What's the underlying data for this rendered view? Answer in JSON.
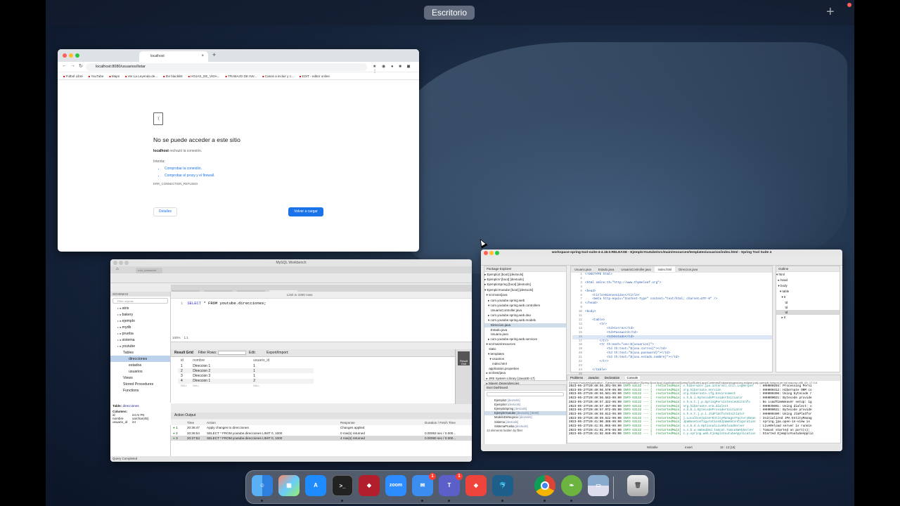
{
  "desktop": {
    "space_label": "Escritorio",
    "add_label": "+"
  },
  "chrome": {
    "tab_title": "localhost",
    "tab_close": "×",
    "new_tab": "+",
    "url": "localhost:8080/usuarios/listar",
    "bookmarks": [
      "Fútbol Libre",
      "YouTube",
      "Maps",
      "Ver La Leyenda de...",
      "the blacklist",
      "HOJAS_DE_VIDA...",
      "TRABAJO DE INV...",
      "Casos a incluir y c...",
      "EDIT - editor online"
    ],
    "heading": "No se puede acceder a este sitio",
    "host": "localhost",
    "message": "rechazó la conexión.",
    "try_label": "Intenta:",
    "suggestions": [
      "Comprobar la conexión.",
      "Comprobar el proxy y el firewall."
    ],
    "error_code": "ERR_CONNECTION_REFUSED",
    "details_button": "Detalles",
    "reload_button": "Volver a cargar"
  },
  "workbench": {
    "title": "MySQL Workbench",
    "connection_tab": "root_password",
    "query_tabs": [
      "Administration",
      "Schemas",
      "Query 1",
      "usuarios",
      "estados",
      "direcciones"
    ],
    "schemas_header": "SCHEMAS",
    "filter_placeholder": "Filter objects",
    "schemas": [
      "atrix",
      "bakery",
      "ejemplo",
      "mydb",
      "prueba",
      "sistema",
      "youtube"
    ],
    "tables_label": "Tables",
    "tables": [
      "direcciones",
      "estados",
      "usuarios"
    ],
    "views_label": "Views",
    "procedures_label": "Stored Procedures",
    "functions_label": "Functions",
    "limit_label": "Limit to 1000 rows",
    "query_line": "1",
    "query_kw1": "SELECT",
    "query_rest": "* FROM youtube.direcciones;",
    "zoom": "100%",
    "cursor_pos": "1:1",
    "result_grid_label": "Result Grid",
    "filter_rows_label": "Filter Rows:",
    "edit_label": "Edit:",
    "export_label": "Export/Import:",
    "result_grid_side": "Result Grid",
    "grid_headers": [
      "id",
      "nombre",
      "usuario_id"
    ],
    "grid_rows": [
      [
        "1",
        "Direccion 1",
        "1"
      ],
      [
        "2",
        "Direccion 2",
        "1"
      ],
      [
        "3",
        "Direccion 3",
        "1"
      ],
      [
        "4",
        "Direccion 1",
        "2"
      ],
      [
        "NULL",
        "NULL",
        "NULL"
      ]
    ],
    "info_table_prefix": "Table:",
    "info_table": "direcciones",
    "info_columns_label": "Columns:",
    "info_columns": [
      [
        "id",
        "int AI PK"
      ],
      [
        "nombre",
        "varchar(45)"
      ],
      [
        "usuario_id",
        "int"
      ]
    ],
    "output_label": "Action Output",
    "output_headers": [
      "",
      "Time",
      "Action",
      "Response",
      "Duration / Fetch Time"
    ],
    "output_rows": [
      [
        "1",
        "20:36:47",
        "Apply changes to direcciones",
        "Changes applied",
        ""
      ],
      [
        "2",
        "20:36:54",
        "SELECT * FROM youtube.direcciones LIMIT 0, 1000",
        "0 row(s) returned",
        "0.00063 sec / 0.000..."
      ],
      [
        "3",
        "20:37:53",
        "SELECT * FROM youtube.direcciones LIMIT 0, 1000",
        "4 row(s) returned",
        "0.00060 sec / 0.000..."
      ]
    ],
    "status": "Query Completed"
  },
  "sts": {
    "title": "workspace-spring-tool-suite-4-4.18.0.RELEASE - EjemploYoutube/src/main/resources/templates/usuarios/index.html - Spring Tool Suite 4",
    "explorer_label": "Package Explorer",
    "explorer_items": [
      "▸ Ejemplo2 [boot] [devtools]",
      "▸ EjemploV [boot] [devtools]",
      "▸ EjemploSpring [boot] [devtools]",
      "▾ EjemploYoutube [boot] [devtools]",
      "  ▾ src/main/java",
      "    ▸ com.youtube.spring.web",
      "    ▾ com.youtube.spring.web.controllers",
      "       UsuarioController.java",
      "    ▸ com.youtube.spring.web.dao",
      "    ▾ com.youtube.spring.web.models",
      "       Direccion.java",
      "       Estado.java",
      "       Usuario.java",
      "    ▸ com.youtube.spring.web.services",
      "  ▾ src/main/resources",
      "     static",
      "    ▾ templates",
      "      ▾ usuarios",
      "         index.html",
      "     application.properties",
      "  ▸ src/test/java",
      "  ▸ JRE System Library [JavaSE-17]",
      "  ▸ Maven Dependencies"
    ],
    "explorer_selected": 10,
    "editor_tabs": [
      "Usuario.java",
      "Estado.java",
      "UsuarioController.java",
      "index.html",
      "Direccion.java"
    ],
    "editor_active_tab": 3,
    "code": [
      [
        "1",
        "<!DOCTYPE html>"
      ],
      [
        "2",
        ""
      ],
      [
        "3",
        "<html xmlns:th=\"http://www.thymeleaf.org\">"
      ],
      [
        "4",
        ""
      ],
      [
        "5",
        "<head>"
      ],
      [
        "6",
        "    <title>Bienvenidos</title>"
      ],
      [
        "7",
        "    <meta http-equiv=\"Content-Type\" content=\"text/html; charset=UTF-8\" />"
      ],
      [
        "8",
        "</head>"
      ],
      [
        "9",
        ""
      ],
      [
        "10",
        "<body>"
      ],
      [
        "11",
        ""
      ],
      [
        "12",
        "    <table>"
      ],
      [
        "13",
        "        <tr>"
      ],
      [
        "14",
        "            <td>Correo</td>"
      ],
      [
        "15",
        "            <td>Password</td>"
      ],
      [
        "16",
        "            <td>Estado</td>"
      ],
      [
        "17",
        "        </tr>"
      ],
      [
        "18",
        "        <tr th:each=\"usu:${usuarios}\">"
      ],
      [
        "19",
        "            <td th:text=\"${usu.correo}\"></td>"
      ],
      [
        "20",
        "            <td th:text=\"${usu.password}\"></td>"
      ],
      [
        "21",
        "            <td th:text=\"${usu.estado.nombre}\"></td>"
      ],
      [
        "22",
        "        </tr>"
      ],
      [
        "23",
        ""
      ],
      [
        "24",
        "    </table>"
      ],
      [
        "25",
        ""
      ]
    ],
    "outline_label": "Outline",
    "outline_items": [
      "▾ html",
      "  ▸ head",
      "  ▾ body",
      "    ▾ table",
      "      ▾ tr",
      "          td",
      "          td",
      "          td",
      "      ▸ tr"
    ],
    "outline_selected": 7,
    "boot_label": "Boot Dashboard",
    "boot_items": [
      [
        "Ejemplo2",
        "[devtools]"
      ],
      [
        "EjemploV",
        "[devtools]"
      ],
      [
        "EjemploSpring",
        "[devtools]"
      ],
      [
        "EjemploYoutube",
        "[devtools] [:8080]"
      ],
      [
        "ModeloDeNegocio",
        "[devtools]"
      ],
      [
        "Sistema",
        "[devtools]"
      ],
      [
        "SistemaPrueba",
        "[devtools]"
      ]
    ],
    "boot_selected": 3,
    "boot_footer": "13 elements hidden by filter",
    "console_tabs": [
      "Problems",
      "Javadoc",
      "Declaration",
      "Console"
    ],
    "console_title": "EjemploYoutubeApplication - EjemploYoutubeApplication [Spring Boot App] /Applications/SpringToolSuite4.app/Contents/Eclipse/plugins/org.eclipse.justj.openjdk.hotspot.jre.full.macosx.x86_64_17.0.6",
    "console_lines": [
      [
        "2023-05-27T20:40:56.391-05:00",
        "o.hibernate.jpa.internal.util.LogHelper",
        ": HHH000204: Processing Persi"
      ],
      [
        "2023-05-27T20:40:56.570-05:00",
        "org.hibernate.Version",
        ": HHH000412: Hibernate ORM co"
      ],
      [
        "2023-05-27T20:40:56.581-05:00",
        "org.hibernate.cfg.Environment",
        ": HHH000406: Using bytecode r"
      ],
      [
        "2023-05-27T20:40:56.583-05:00",
        "o.h.b.i.BytecodeProviderInitiator",
        ": HHH000021: Bytecode provide"
      ],
      [
        "2023-05-27T20:40:57.322-05:00",
        "o.h.e.t.j.p.SpringPersistenceUnitInfo",
        ": No LoadTimeWeaver setup: ig"
      ],
      [
        "2023-05-27T20:40:57.467-05:00",
        "org.hibernate.orm.dialect",
        ": HHH035001: Using dialect: o"
      ],
      [
        "2023-05-27T20:40:57.972-05:00",
        "o.h.b.i.BytecodeProviderInitiator",
        ": HHH000021: Bytecode provide"
      ],
      [
        "2023-05-27T20:40:59.613-05:00",
        "o.h.e.t.j.p.i.JtaPlatformInitiator",
        ": HHH000490: Using JtaPlatfor"
      ],
      [
        "2023-05-27T20:40:59.622-05:00",
        "j.LocalContainerEntityManagerFactoryBean",
        ": Initialized JPA EntityManag"
      ],
      [
        "2023-05-27T20:41:00.386-05:00",
        "JpaBaseConfiguration$JpaWebConfiguration",
        ": spring.jpa.open-in-view is"
      ],
      [
        "2023-05-27T20:41:01.065-05:00",
        "o.s.b.d.a.OptionalLiveReloadServer",
        ": LiveReload server is runnin"
      ],
      [
        "2023-05-27T20:41:01.978-05:00",
        "o.s.b.w.embedded.tomcat.TomcatWebServer",
        ": Tomcat started on port(s):"
      ],
      [
        "2023-05-27T20:41:02.040-05:00",
        "c.y.spring.web.EjemploYoutubeApplication",
        ": Started EjemploYoutubeApplic"
      ]
    ],
    "console_info": "INFO 63132 --- [  restartedMain]",
    "status_writable": "Writable",
    "status_insert": "Insert",
    "status_pos": "16 : 13 [15]"
  },
  "dock": {
    "apps": [
      "finder-icon",
      "launchpad-icon",
      "app-store-icon",
      "terminal-icon",
      "jaspersoft-icon",
      "zoom-icon",
      "mail-icon",
      "teams-icon",
      "anydesk-icon",
      "mysql-workbench-icon",
      "chrome-icon",
      "spring-tool-suite-icon",
      "preview-icon",
      "trash-icon"
    ],
    "zoom_label": "zoom",
    "mail_badge": "1",
    "teams_badge": "1"
  }
}
